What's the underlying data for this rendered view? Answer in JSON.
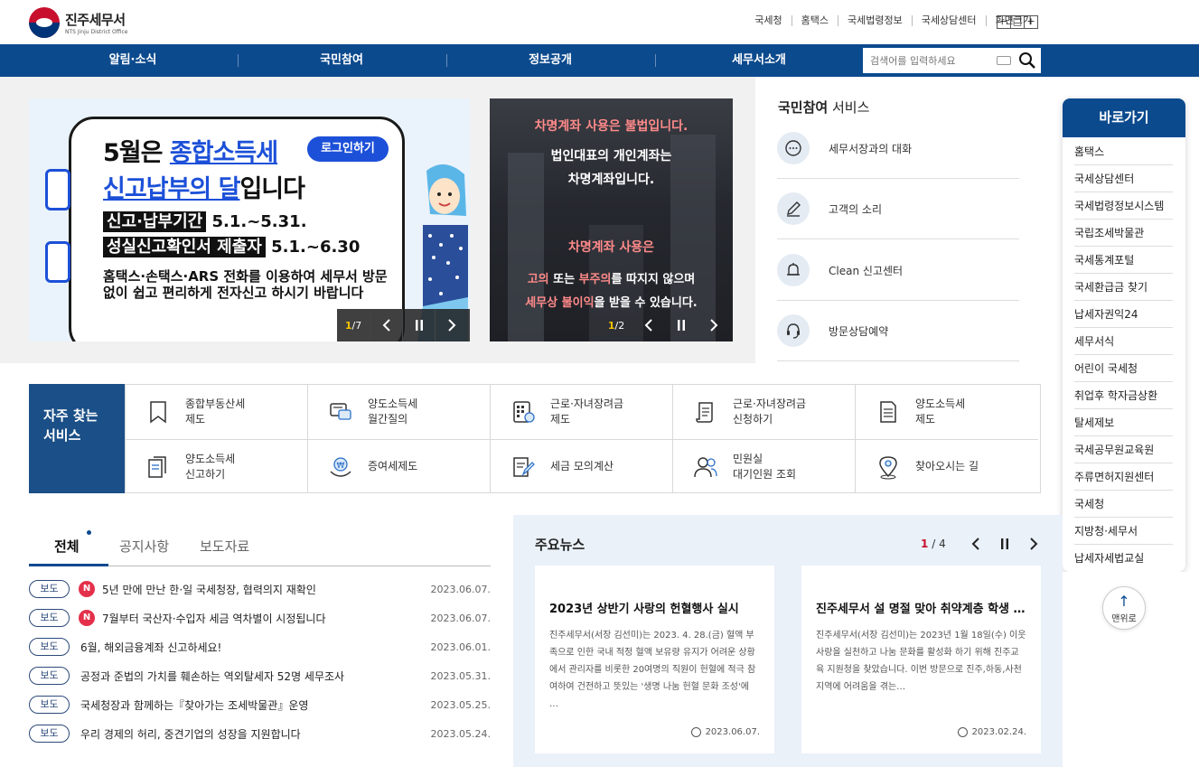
{
  "header": {
    "site_title": "진주세무서",
    "site_subtitle": "NTS Jinju District Office",
    "util_links": [
      "국세청",
      "홈택스",
      "국세법령정보",
      "국세상담센터",
      "화면크기"
    ],
    "zoom_minus": "−",
    "zoom_reset": "□",
    "zoom_plus": "+"
  },
  "nav": {
    "items": [
      "알림·소식",
      "국민참여",
      "정보공개",
      "세무서소개"
    ],
    "search_placeholder": "검색어를 입력하세요"
  },
  "banner1": {
    "line1_a": "5월은 ",
    "line1_b": "종합소득세",
    "login_button": "로그인하기",
    "line2_a": "신고납부의 달",
    "line2_b": "입니다",
    "row1_tag": "신고·납부기간",
    "row1_val": " 5.1.~5.31.",
    "row2_tag": "성실신고확인서 제출자",
    "row2_val": " 5.1.~6.30",
    "desc": "홈택스·손택스·ARS 전화를 이용하여 세무서 방문 없이 쉽고 편리하게 전자신고 하시기 바랍니다",
    "page_current": "1",
    "page_total": "7"
  },
  "banner2": {
    "title1": "차명계좌 사용은 불법입니다.",
    "title2_line1": "법인대표의 개인계좌는",
    "title2_line2": "차명계좌입니다.",
    "title3": "차명계좌 사용은",
    "line4_a": "고의",
    "line4_b": " 또는 ",
    "line4_c": "부주의",
    "line4_d": "를 따지지 않으며",
    "line5_a": "세무상 불이익",
    "line5_b": "을 받을 수 있습니다.",
    "page_current": "1",
    "page_total": "2"
  },
  "citizen_service": {
    "title_bold": "국민참여",
    "title_rest": " 서비스",
    "items": [
      {
        "label": "세무서장과의 대화",
        "icon": "chat-bubble-icon"
      },
      {
        "label": "고객의 소리",
        "icon": "pencil-icon"
      },
      {
        "label": "Clean 신고센터",
        "icon": "bell-icon"
      },
      {
        "label": "방문상담예약",
        "icon": "headset-icon"
      }
    ]
  },
  "quick_links": {
    "title": "바로가기",
    "items": [
      "홈택스",
      "국세상담센터",
      "국세법령정보시스템",
      "국립조세박물관",
      "국세통계포털",
      "국세환급금 찾기",
      "납세자권익24",
      "세무서식",
      "어린이 국세청",
      "취업후 학자금상환",
      "탈세제보",
      "국세공무원교육원",
      "주류면허지원센터",
      "국세청",
      "지방청·세무서",
      "납세자세법교실"
    ],
    "top_button": "맨위로"
  },
  "frequent": {
    "title_line1": "자주 찾는",
    "title_line2": "서비스",
    "items": [
      {
        "l1": "종합부동산세",
        "l2": "제도",
        "icon": "bookmark-icon"
      },
      {
        "l1": "양도소득세",
        "l2": "월간질의",
        "icon": "consult-icon"
      },
      {
        "l1": "근로·자녀장려금",
        "l2": "제도",
        "icon": "calculator-icon"
      },
      {
        "l1": "근로·자녀장려금",
        "l2": "신청하기",
        "icon": "scroll-icon"
      },
      {
        "l1": "양도소득세",
        "l2": "제도",
        "icon": "document-icon"
      },
      {
        "l1": "양도소득세",
        "l2": "신고하기",
        "icon": "documents-icon"
      },
      {
        "l1": "증여세제도",
        "l2": "",
        "icon": "won-hand-icon"
      },
      {
        "l1": "세금 모의계산",
        "l2": "",
        "icon": "form-pen-icon"
      },
      {
        "l1": "민원실",
        "l2": "대기인원 조회",
        "icon": "people-icon"
      },
      {
        "l1": "찾아오시는 길",
        "l2": "",
        "icon": "map-pin-icon"
      }
    ]
  },
  "notices": {
    "tabs": [
      "전체",
      "공지사항",
      "보도자료"
    ],
    "items": [
      {
        "badge": "보도",
        "new": "N",
        "title": "5년 만에 만난 한·일 국세청장, 협력의지 재확인",
        "date": "2023.06.07."
      },
      {
        "badge": "보도",
        "new": "N",
        "title": "7월부터 국산자·수입자 세금 역차별이 시정됩니다",
        "date": "2023.06.07."
      },
      {
        "badge": "보도",
        "new": "",
        "title": "6월, 해외금융계좌 신고하세요!",
        "date": "2023.06.01."
      },
      {
        "badge": "보도",
        "new": "",
        "title": "공정과 준법의 가치를 훼손하는 역외탈세자 52명 세무조사",
        "date": "2023.05.31."
      },
      {
        "badge": "보도",
        "new": "",
        "title": "국세청장과 함께하는『찾아가는 조세박물관』운영",
        "date": "2023.05.25."
      },
      {
        "badge": "보도",
        "new": "",
        "title": "우리 경제의 허리, 중견기업의 성장을 지원합니다",
        "date": "2023.05.24."
      }
    ]
  },
  "news": {
    "title": "주요뉴스",
    "page_current": "1",
    "page_sep": "/",
    "page_total": "4",
    "cards": [
      {
        "title": "2023년 상반기 사랑의 헌혈행사 실시",
        "body": "진주세무서(서장 김선미)는 2023. 4. 28.(금) 혈액 부족으로 인한 국내 적정 혈액 보유량 유지가 어려운 상황에서 관리자를 비롯한 20여명의 직원이 헌혈에 적극 참여하여 건전하고 뜻있는 '생명 나눔 헌혈 문화 조성'에 …",
        "date": "2023.06.07."
      },
      {
        "title": "진주세무서 설 명절 맞아 취약계층 학생 …",
        "body": "진주세무서(서장 김선미)는 2023년 1월 18일(수) 이웃 사랑을 실천하고 나눔 문화를 활성화 하기 위해 진주교육 지원청을 찾았습니다. 이번 방문으로 진주,하동,사천 지역에 어려움을 겪는…",
        "date": "2023.02.24."
      }
    ]
  },
  "colors": {
    "brand_blue": "#0c4a8e",
    "accent_red": "#c8102e",
    "new_badge": "#e4304a"
  }
}
